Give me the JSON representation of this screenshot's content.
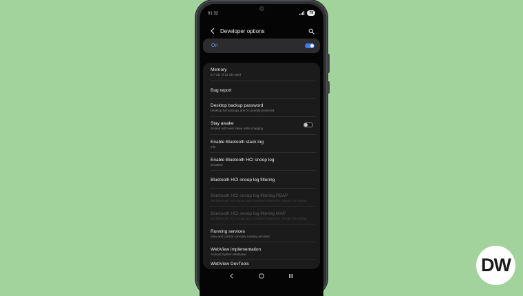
{
  "status_bar": {
    "time": "01:32",
    "battery": "79"
  },
  "header": {
    "title": "Developer options",
    "back_icon": "back-arrow-icon",
    "search_icon": "search-icon"
  },
  "master_toggle": {
    "label": "On",
    "state": true
  },
  "settings": [
    {
      "title": "Memory",
      "subtitle": "5.7 GB of 12 GB used",
      "enabled": true
    },
    {
      "title": "Bug report",
      "subtitle": "",
      "enabled": true
    },
    {
      "title": "Desktop backup password",
      "subtitle": "Desktop full backups aren't currently protected",
      "enabled": true
    },
    {
      "title": "Stay awake",
      "subtitle": "Screen will never sleep while charging",
      "enabled": true,
      "toggle": false
    },
    {
      "title": "Enable Bluetooth stack log",
      "subtitle": "Info",
      "enabled": true
    },
    {
      "title": "Enable Bluetooth HCI snoop log",
      "subtitle": "Disabled",
      "enabled": true
    },
    {
      "title": "Bluetooth HCI snoop log filtering",
      "subtitle": "",
      "enabled": true
    },
    {
      "title": "Bluetooth HCI snoop log filtering PBAP",
      "subtitle": "Set Bluetooth HCI snoop log to Enabled Filtered to change this setting",
      "enabled": false
    },
    {
      "title": "Bluetooth HCI snoop log filtering MAP",
      "subtitle": "Set Bluetooth HCI snoop log to Enabled Filtered to change this setting",
      "enabled": false
    },
    {
      "title": "Running services",
      "subtitle": "View and control currently running services",
      "enabled": true
    },
    {
      "title": "WebView implementation",
      "subtitle": "Android System WebView",
      "enabled": true
    },
    {
      "title": "WebView DevTools",
      "subtitle": "",
      "enabled": true
    }
  ],
  "nav_bar": {
    "back_icon": "nav-back-icon",
    "home_icon": "home-icon",
    "recents_icon": "recents-icon"
  },
  "watermark": {
    "text": "DW"
  },
  "colors": {
    "background": "#a3d39c",
    "accent": "#3e7be8",
    "on_label": "#6e97e8",
    "card": "#1b1b1c"
  }
}
